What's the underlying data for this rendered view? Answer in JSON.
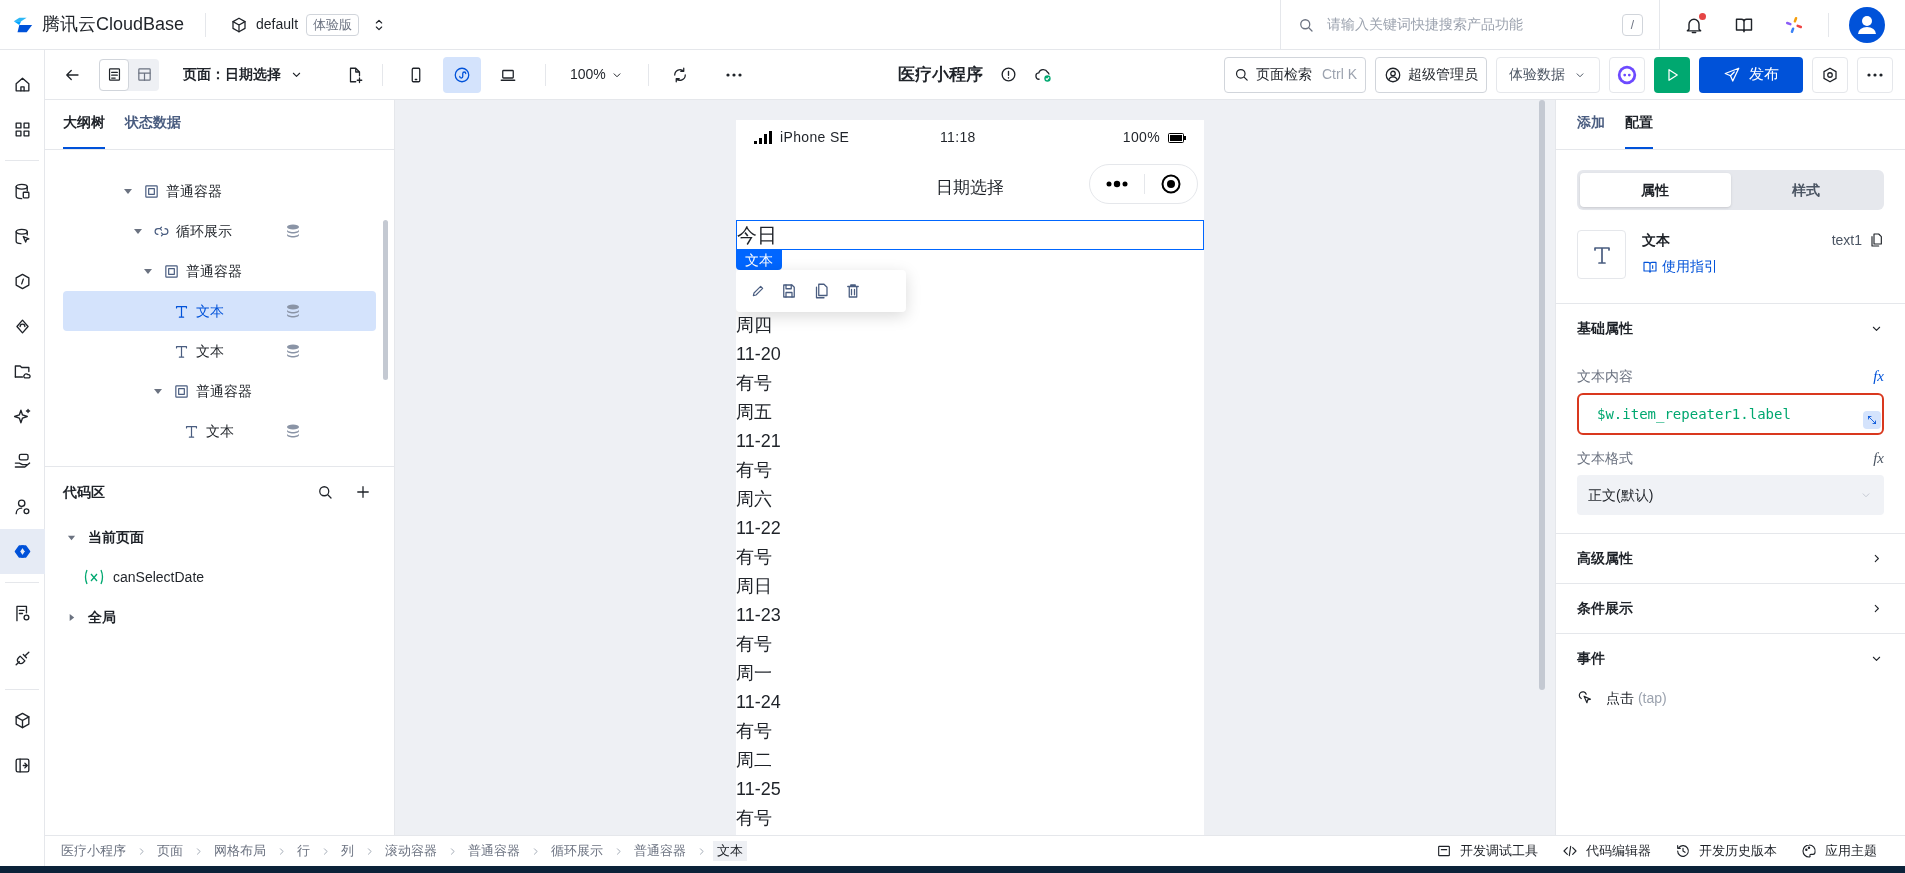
{
  "header": {
    "brand": "腾讯云CloudBase",
    "env": "default",
    "env_badge": "体验版",
    "search": {
      "placeholder": "请输入关键词快捷搜索产品功能",
      "shortcut": "/"
    },
    "notifications_unread": true
  },
  "rail": {
    "groups": [
      {
        "items": [
          {
            "kind": "home",
            "selected": false
          },
          {
            "kind": "apps",
            "selected": false
          }
        ]
      },
      {
        "items": [
          {
            "kind": "database",
            "selected": false
          },
          {
            "kind": "database-pointer",
            "selected": false
          },
          {
            "kind": "function",
            "selected": false
          },
          {
            "kind": "flow",
            "selected": false
          },
          {
            "kind": "storage",
            "selected": false
          },
          {
            "kind": "ai",
            "selected": false
          },
          {
            "kind": "hand",
            "selected": false
          },
          {
            "kind": "user",
            "selected": false
          },
          {
            "kind": "builder",
            "selected": true
          }
        ]
      },
      {
        "items": [
          {
            "kind": "report",
            "selected": false
          },
          {
            "kind": "plug",
            "selected": false
          }
        ]
      },
      {
        "items": [
          {
            "kind": "cube",
            "selected": false
          },
          {
            "kind": "collapse",
            "selected": false
          }
        ]
      }
    ]
  },
  "toolbar": {
    "view_modes": [
      {
        "kind": "list",
        "selected": true
      },
      {
        "kind": "layout",
        "selected": false
      }
    ],
    "page_select": "页面：日期选择",
    "devices": [
      {
        "kind": "phone",
        "selected": false
      },
      {
        "kind": "miniprogram",
        "selected": true
      },
      {
        "kind": "desktop",
        "selected": false
      }
    ],
    "zoom": "100%",
    "app_title": "医疗小程序",
    "page_search": {
      "label": "页面检索",
      "shortcut": "Ctrl K"
    },
    "role": "超级管理员",
    "data_select": "体验数据",
    "publish": "发布"
  },
  "outline": {
    "tabs": [
      {
        "label": "大纲树",
        "selected": true
      },
      {
        "label": "状态数据",
        "selected": false
      }
    ],
    "tree": [
      {
        "label": "普通容器",
        "kind": "container",
        "expanded": true,
        "bound": false,
        "selected": false,
        "children": [
          {
            "label": "循环展示",
            "kind": "repeater",
            "expanded": true,
            "bound": true,
            "selected": false,
            "children": [
              {
                "label": "普通容器",
                "kind": "container",
                "expanded": true,
                "bound": false,
                "selected": false,
                "children": [
                  {
                    "label": "文本",
                    "kind": "text",
                    "bound": true,
                    "selected": true
                  },
                  {
                    "label": "文本",
                    "kind": "text",
                    "bound": true,
                    "selected": false
                  },
                  {
                    "label": "普通容器",
                    "kind": "container",
                    "expanded": true,
                    "bound": false,
                    "selected": false,
                    "children": [
                      {
                        "label": "文本",
                        "kind": "text",
                        "bound": true,
                        "selected": false
                      }
                    ]
                  }
                ]
              }
            ]
          }
        ]
      }
    ]
  },
  "code_area": {
    "title": "代码区",
    "groups": [
      {
        "label": "当前页面",
        "expanded": true,
        "items": [
          {
            "name": "canSelectDate"
          }
        ]
      },
      {
        "label": "全局",
        "expanded": false
      }
    ]
  },
  "preview": {
    "device": "iPhone SE",
    "time": "11:18",
    "battery": "100%",
    "nav_title": "日期选择",
    "selected_item": {
      "text": "今日",
      "tag": "文本"
    },
    "items": [
      "周四",
      "11-20",
      "有号",
      "周五",
      "11-21",
      "有号",
      "周六",
      "11-22",
      "有号",
      "周日",
      "11-23",
      "有号",
      "周一",
      "11-24",
      "有号",
      "周二",
      "11-25",
      "有号"
    ]
  },
  "config": {
    "tabs": [
      {
        "label": "添加",
        "selected": false
      },
      {
        "label": "配置",
        "selected": true
      }
    ],
    "segments": [
      {
        "label": "属性",
        "selected": true
      },
      {
        "label": "样式",
        "selected": false
      }
    ],
    "component": {
      "name": "文本",
      "guide": "使用指引",
      "id": "text1"
    },
    "sections": [
      {
        "title": "基础属性",
        "expanded": true,
        "fields": [
          {
            "label": "文本内容",
            "kind": "expression",
            "formula": "fx",
            "value": "$w.item_repeater1.label"
          },
          {
            "label": "文本格式",
            "kind": "select",
            "formula": "fx",
            "value": "正文(默认)"
          }
        ]
      },
      {
        "title": "高级属性",
        "expanded": false
      },
      {
        "title": "条件展示",
        "expanded": false
      },
      {
        "title": "事件",
        "expanded": true,
        "events": [
          {
            "label": "点击",
            "code": "(tap)"
          }
        ]
      }
    ]
  },
  "breadcrumb": [
    {
      "label": "医疗小程序",
      "selected": false
    },
    {
      "label": "页面",
      "selected": false
    },
    {
      "label": "网格布局",
      "selected": false
    },
    {
      "label": "行",
      "selected": false
    },
    {
      "label": "列",
      "selected": false
    },
    {
      "label": "滚动容器",
      "selected": false
    },
    {
      "label": "普通容器",
      "selected": false
    },
    {
      "label": "循环展示",
      "selected": false
    },
    {
      "label": "普通容器",
      "selected": false
    },
    {
      "label": "文本",
      "selected": true
    }
  ],
  "footer_tools": [
    {
      "kind": "debug",
      "label": "开发调试工具"
    },
    {
      "kind": "code",
      "label": "代码编辑器"
    },
    {
      "kind": "history",
      "label": "开发历史版本"
    },
    {
      "kind": "theme",
      "label": "应用主题"
    }
  ]
}
